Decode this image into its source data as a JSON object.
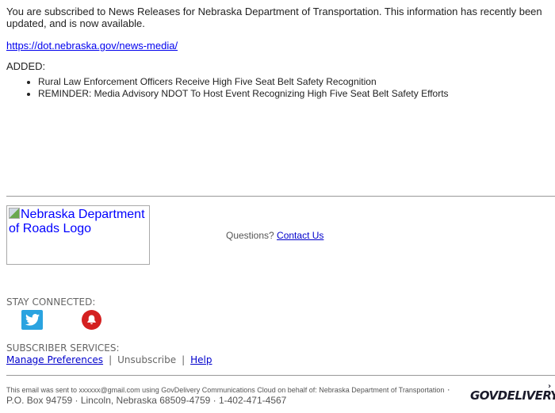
{
  "intro": {
    "text": "You are subscribed to News Releases for Nebraska Department of Transportation. This information has recently been updated, and is now available."
  },
  "news_link": "https://dot.nebraska.gov/news-media/",
  "added_label": "ADDED:",
  "items": [
    "Rural Law Enforcement Officers Receive High Five Seat Belt Safety Recognition",
    "REMINDER: Media Advisory NDOT To Host Event Recognizing High Five Seat Belt Safety Efforts"
  ],
  "logo": {
    "alt_text": "Nebraska Department of Roads Logo"
  },
  "questions": {
    "label": "Questions?",
    "contact_link": "Contact Us"
  },
  "stay_connected": {
    "label": "STAY CONNECTED:",
    "icons": [
      "twitter-icon",
      "bell-icon"
    ]
  },
  "subscriber_services": {
    "label": "SUBSCRIBER SERVICES:",
    "manage_preferences": "Manage Preferences",
    "separator": "|",
    "unsubscribe": "Unsubscribe",
    "help": "Help"
  },
  "footer": {
    "line1": "This email was sent to xxxxxx@gmail.com using GovDelivery Communications Cloud on behalf of: Nebraska Department of Transportation",
    "address": " · P.O. Box 94759 · Lincoln, Nebraska 68509-4759 · 1-402-471-4567",
    "brand": "GOVDELIVERY"
  },
  "colors": {
    "link": "#0000ee",
    "twitter": "#2aa3e0",
    "bell": "#d42020"
  }
}
